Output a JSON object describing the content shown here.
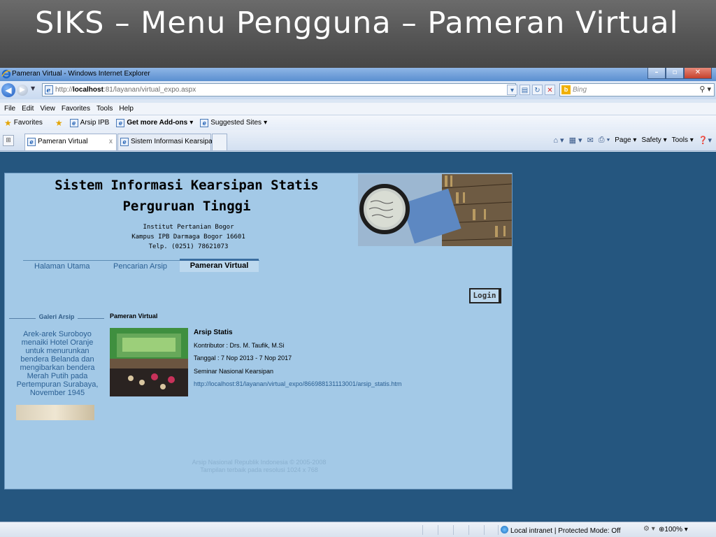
{
  "slide": {
    "title": "SIKS – Menu Pengguna – Pameran Virtual"
  },
  "window": {
    "title": "Pameran Virtual - Windows Internet Explorer"
  },
  "address": {
    "url_prefix": "http://",
    "url_host": "localhost",
    "url_rest": ":81/layanan/virtual_expo.aspx",
    "search_placeholder": "Bing"
  },
  "menu": [
    "File",
    "Edit",
    "View",
    "Favorites",
    "Tools",
    "Help"
  ],
  "favorites_bar": {
    "favorites_label": "Favorites",
    "items": [
      "Arsip IPB",
      "Get more Add-ons",
      "Suggested Sites"
    ]
  },
  "tabs": [
    {
      "label": "Pameran Virtual",
      "close": "x"
    },
    {
      "label": "Sistem Informasi Kearsipa..."
    }
  ],
  "command_bar": {
    "page": "Page",
    "safety": "Safety",
    "tools": "Tools"
  },
  "site": {
    "title_line1": "Sistem Informasi Kearsipan Statis",
    "title_line2": "Perguruan Tinggi",
    "address_line1": "Institut Pertanian Bogor",
    "address_line2": "Kampus IPB Darmaga Bogor 16601",
    "address_line3": "Telp. (0251) 78621073"
  },
  "nav": {
    "home": "Halaman Utama",
    "search": "Pencarian Arsip",
    "expo": "Pameran Virtual"
  },
  "login_label": "Login",
  "galeri": {
    "heading": "Galeri Arsip",
    "text": "Arek-arek Suroboyo menaiki Hotel Oranje untuk menurunkan bendera Belanda dan mengibarkan bendera Merah Putih pada Pertempuran Surabaya, November 1945"
  },
  "expo": {
    "heading": "Pameran Virtual",
    "item": {
      "title": "Arsip Statis",
      "contributor": "Kontributor : Drs. M. Taufik, M.Si",
      "date": "Tanggal : 7 Nop 2013 - 7 Nop 2017",
      "description": "Seminar Nasional Kearsipan",
      "link": "http://localhost:81/layanan/virtual_expo/866988131113001/arsip_statis.htm"
    }
  },
  "footer": {
    "line1": "Arsip Nasional Republik Indonesia © 2005-2008",
    "line2": "Tampilan terbaik pada resolusi 1024 x 768"
  },
  "status": {
    "zone": "Local intranet | Protected Mode: Off",
    "zoom": "100%"
  }
}
